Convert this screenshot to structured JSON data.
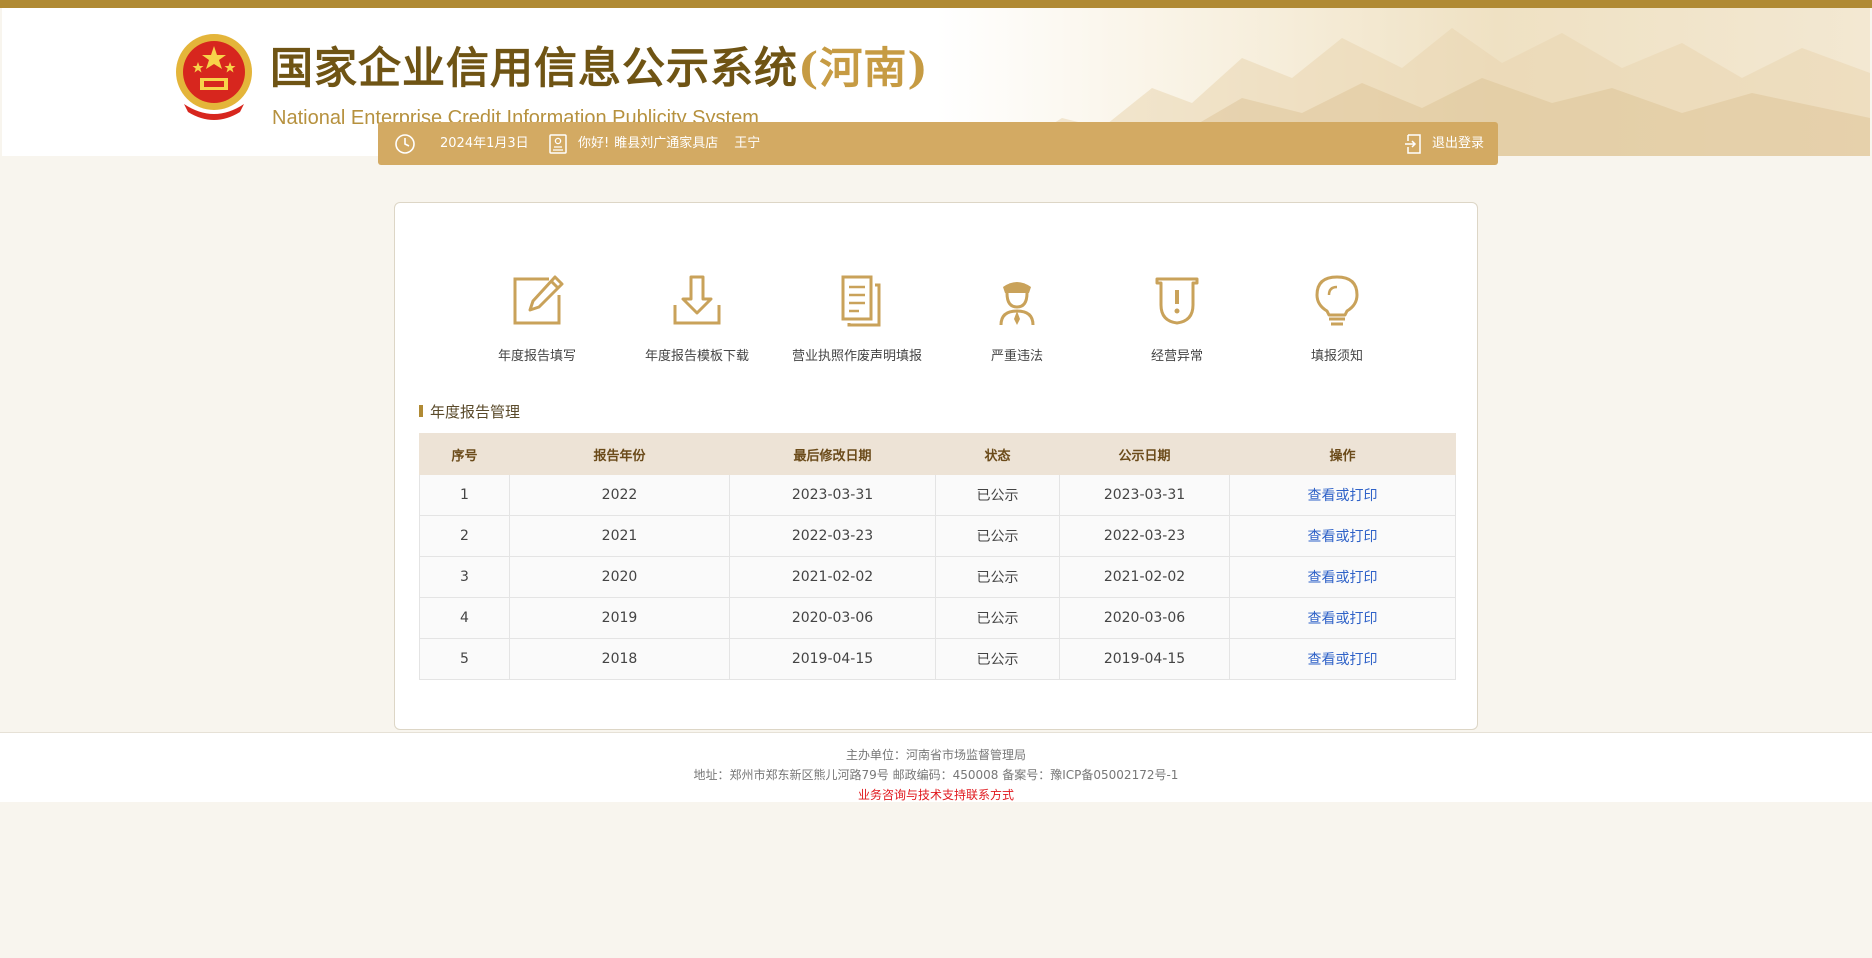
{
  "header": {
    "title_cn": "国家企业信用信息公示系统",
    "title_region": "(河南)",
    "title_en": "National Enterprise Credit Information Publicity System"
  },
  "infobar": {
    "date": "2024年1月3日",
    "greeting": "你好!",
    "company": "睢县刘广通家具店",
    "user": "王宁",
    "logout_label": "退出登录"
  },
  "nav": [
    {
      "label": "年度报告填写",
      "icon": "edit-icon"
    },
    {
      "label": "年度报告模板下载",
      "icon": "download-icon"
    },
    {
      "label": "营业执照作废声明填报",
      "icon": "document-icon"
    },
    {
      "label": "严重违法",
      "icon": "officer-icon"
    },
    {
      "label": "经营异常",
      "icon": "warning-shield-icon"
    },
    {
      "label": "填报须知",
      "icon": "lightbulb-icon"
    }
  ],
  "section_title": "年度报告管理",
  "table": {
    "columns": [
      "序号",
      "报告年份",
      "最后修改日期",
      "状态",
      "公示日期",
      "操作"
    ],
    "rows": [
      {
        "no": "1",
        "year": "2022",
        "modified": "2023-03-31",
        "status": "已公示",
        "published": "2023-03-31",
        "action": "查看或打印"
      },
      {
        "no": "2",
        "year": "2021",
        "modified": "2022-03-23",
        "status": "已公示",
        "published": "2022-03-23",
        "action": "查看或打印"
      },
      {
        "no": "3",
        "year": "2020",
        "modified": "2021-02-02",
        "status": "已公示",
        "published": "2021-02-02",
        "action": "查看或打印"
      },
      {
        "no": "4",
        "year": "2019",
        "modified": "2020-03-06",
        "status": "已公示",
        "published": "2020-03-06",
        "action": "查看或打印"
      },
      {
        "no": "5",
        "year": "2018",
        "modified": "2019-04-15",
        "status": "已公示",
        "published": "2019-04-15",
        "action": "查看或打印"
      }
    ]
  },
  "footer": {
    "sponsor": "主办单位：河南省市场监督管理局",
    "address": "地址：郑州市郑东新区熊儿河路79号 邮政编码：450008 备案号：豫ICP备05002172号-1",
    "support": "业务咨询与技术支持联系方式"
  },
  "colors": {
    "accent": "#d3aa63",
    "brand_dark": "#6f5414",
    "link": "#2f62c8",
    "alert": "#e0191e"
  }
}
